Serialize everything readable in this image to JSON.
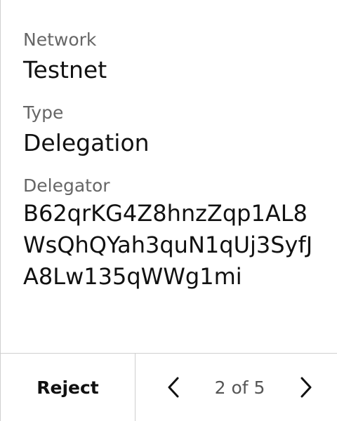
{
  "fields": {
    "network": {
      "label": "Network",
      "value": "Testnet"
    },
    "type": {
      "label": "Type",
      "value": "Delegation"
    },
    "delegator": {
      "label": "Delegator",
      "value": "B62qrKG4Z8hnzZqp1AL8WsQhQYah3quN1qUj3SyfJA8Lw135qWWg1mi"
    }
  },
  "footer": {
    "reject_label": "Reject",
    "page_indicator": "2 of 5",
    "prev_icon": "chevron-left-icon",
    "next_icon": "chevron-right-icon"
  }
}
